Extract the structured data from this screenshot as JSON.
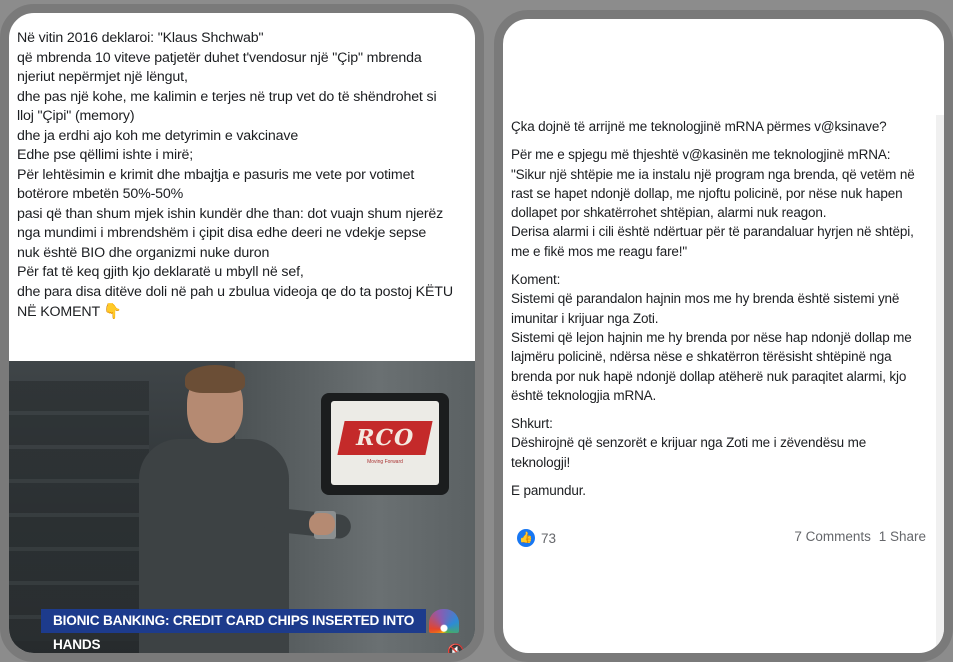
{
  "left_post": {
    "lines": [
      "Në vitin 2016 deklaroi: \"Klaus Shchwab\"",
      "që mbrenda 10 viteve patjetër duhet t'vendosur një \"Çip\" mbrenda",
      "njeriut nepërmjet një lëngut,",
      "dhe pas një kohe, me kalimin e terjes në trup vet do të shëndrohet si",
      "lloj \"Çipi\" (memory)",
      "dhe ja erdhi ajo koh me detyrimin e vakcinave",
      "Edhe pse qëllimi ishte i mirë;",
      "Për lehtësimin e krimit dhe mbajtja e pasuris me vete por votimet",
      "botërore mbetën 50%-50%",
      "pasi që than shum mjek ishin kundër dhe than: dot vuajn shum njerëz",
      "nga mundimi i mbrendshëm i çipit disa edhe deeri ne vdekje sepse",
      "nuk është BIO dhe organizmi nuke duron",
      "Për fat të keq gjith kjo deklaratë u mbyll në sef,",
      "dhe para disa ditëve doli në pah u zbulua videoja qe do ta postoj KËTU",
      "NË KOMENT"
    ],
    "pointer_icon": "pointing-hand-icon",
    "video": {
      "screen_logo": "RCO",
      "screen_sub": "Moving Forward",
      "banner": "BIONIC BANKING: CREDIT CARD CHIPS INSERTED INTO HANDS",
      "mute_icon": "speaker-mute-icon"
    }
  },
  "right_post": {
    "paragraphs": [
      [
        "Çka dojnë të arrijnë me teknologjinë mRNA përmes v@ksinave?"
      ],
      [
        "Për me e spjegu më thjeshtë v@kasinën me teknologjinë mRNA:",
        "\"Sikur një shtëpie me ia instalu një program nga brenda, që vetëm në",
        "rast se hapet ndonjë dollap, me njoftu policinë, por nëse nuk hapen",
        "dollapet por shkatërrohet shtëpian, alarmi nuk reagon.",
        "Derisa alarmi i cili është ndërtuar për të parandaluar hyrjen në shtëpi,",
        "me e fikë mos me reagu fare!\""
      ],
      [
        "Koment:",
        "Sistemi që parandalon hajnin mos me hy brenda është sistemi ynë",
        "imunitar i krijuar nga Zoti.",
        "Sistemi që lejon hajnin me hy brenda por nëse hap ndonjë dollap me",
        "lajmëru policinë, ndërsa nëse e shkatërron tërësisht shtëpinë nga",
        "brenda por nuk hapë ndonjë dollap atëherë nuk paraqitet alarmi, kjo",
        "është teknologjia mRNA."
      ],
      [
        "Shkurt:",
        "Dëshirojnë që senzorët e krijuar nga Zoti me i zëvendësu me",
        "teknologji!"
      ],
      [
        "E pamundur."
      ]
    ],
    "like_icon": "thumbs-up-icon",
    "like_count": "73",
    "comments": "7 Comments",
    "shares": "1 Share"
  },
  "colors": {
    "frame": "#7a7a7a",
    "like_blue": "#1877f2",
    "banner_blue": "#1d3b8c",
    "rco_red": "#c42a2a"
  }
}
